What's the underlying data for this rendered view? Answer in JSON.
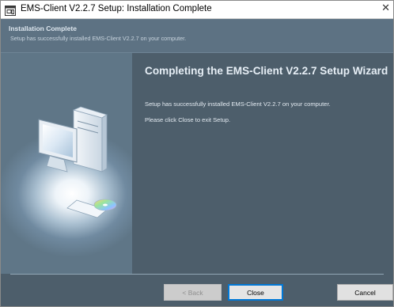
{
  "window": {
    "title": "EMS-Client V2.2.7 Setup: Installation Complete",
    "close_glyph": "✕",
    "app_icon": "installer-window-icon"
  },
  "header": {
    "title": "Installation Complete",
    "subtitle": "Setup has successfully installed EMS-Client V2.2.7 on your computer."
  },
  "content": {
    "heading": "Completing the EMS-Client V2.2.7 Setup Wizard",
    "line1": "Setup has successfully installed EMS-Client V2.2.7 on your computer.",
    "line2": "Please click Close to exit Setup."
  },
  "buttons": {
    "back_label": "< Back",
    "close_label": "Close",
    "cancel_label": "Cancel"
  },
  "sidebar": {
    "illustration_icon": "computer-with-cd-icon"
  },
  "colors": {
    "panel_background": "#4d5e6b",
    "header_background": "#5d7283",
    "accent_focus": "#0078d7"
  }
}
